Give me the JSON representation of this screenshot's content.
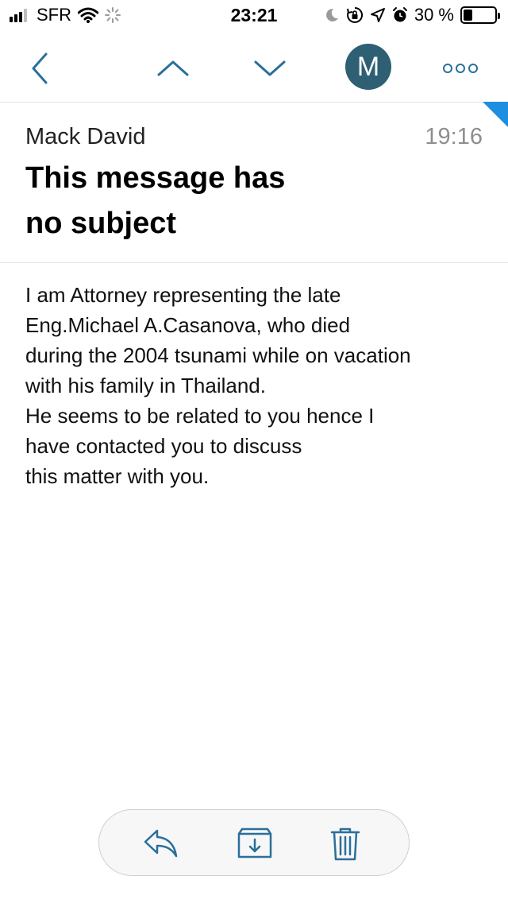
{
  "status_bar": {
    "carrier": "SFR",
    "time": "23:21",
    "battery_text": "30 %",
    "battery_level": 0.3
  },
  "toolbar": {
    "back_icon": "chevron-left-icon",
    "previous_icon": "chevron-up-icon",
    "next_icon": "chevron-down-icon",
    "avatar_initial": "M",
    "more_icon": "more-icon",
    "accent_color": "#2b6f9a",
    "avatar_color": "#2e5f73"
  },
  "message": {
    "sender": "Mack David",
    "time": "19:16",
    "subject_lines": [
      "This message has",
      "no subject"
    ],
    "body_lines": [
      "I am Attorney representing the late",
      "Eng.Michael A.Casanova, who died",
      "during the 2004 tsunami while on vacation",
      "with his family in Thailand.",
      "He seems to be related to you hence I",
      "have contacted you to discuss",
      "this matter with you."
    ],
    "unread_flag_color": "#1e8fe0"
  },
  "actions": {
    "reply_icon": "reply-icon",
    "archive_icon": "archive-icon",
    "delete_icon": "trash-icon"
  }
}
